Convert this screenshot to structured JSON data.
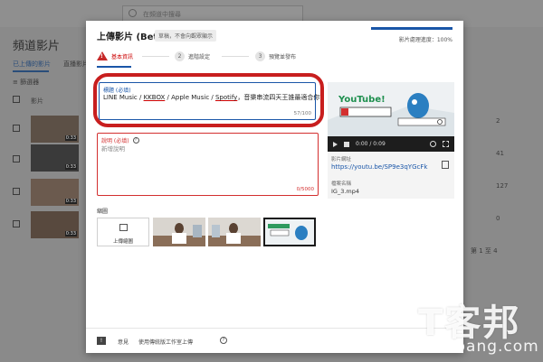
{
  "background": {
    "search_placeholder": "在頻道中搜尋",
    "page_title": "頻道影片",
    "tabs": [
      "已上傳的影片",
      "直播影片"
    ],
    "filter_label": "篩選器",
    "column_header": "影片",
    "durations": [
      "0:33",
      "0:33",
      "0:33",
      "0:33"
    ],
    "right_values": [
      "2",
      "41",
      "127",
      "0"
    ],
    "footer_range": "第 1 至 4"
  },
  "dialog": {
    "title": "上傳影片 (Beta 版)",
    "draft_badge": "草稿，不會向觀眾顯示",
    "progress_text": "影片處理進度：100%",
    "progress_percent": 100,
    "steps": [
      {
        "num": "1",
        "label": "基本資訊"
      },
      {
        "num": "2",
        "label": "進階設定"
      },
      {
        "num": "3",
        "label": "預覽並發布"
      }
    ],
    "title_field": {
      "label": "標題 (必填)",
      "parts": [
        "LINE Music / ",
        "KKBOX",
        " / Apple Music / ",
        "Spotify",
        "，音樂串流四天王誰最適合你？"
      ],
      "counter": "57/100"
    },
    "description_field": {
      "label": "說明 (必填)",
      "placeholder": "新增說明",
      "counter": "0/5000"
    },
    "thumbnail": {
      "label": "縮圖",
      "upload_label": "上傳縮圖"
    },
    "preview": {
      "time": "0:00 / 0:09",
      "link_label": "影片網址",
      "link": "https://youtu.be/SP9e3qYGcFk",
      "file_label": "檔案名稱",
      "file_name": "IG_3.mp4"
    },
    "footer": {
      "feedback": "意見",
      "use_old": "使用傳統版工作室上傳"
    }
  },
  "watermark": {
    "logo": "T客邦",
    "text": "techbang.com"
  },
  "colors": {
    "accent": "#1a56a8",
    "error": "#d32f2f",
    "highlight": "#c81e1e"
  }
}
